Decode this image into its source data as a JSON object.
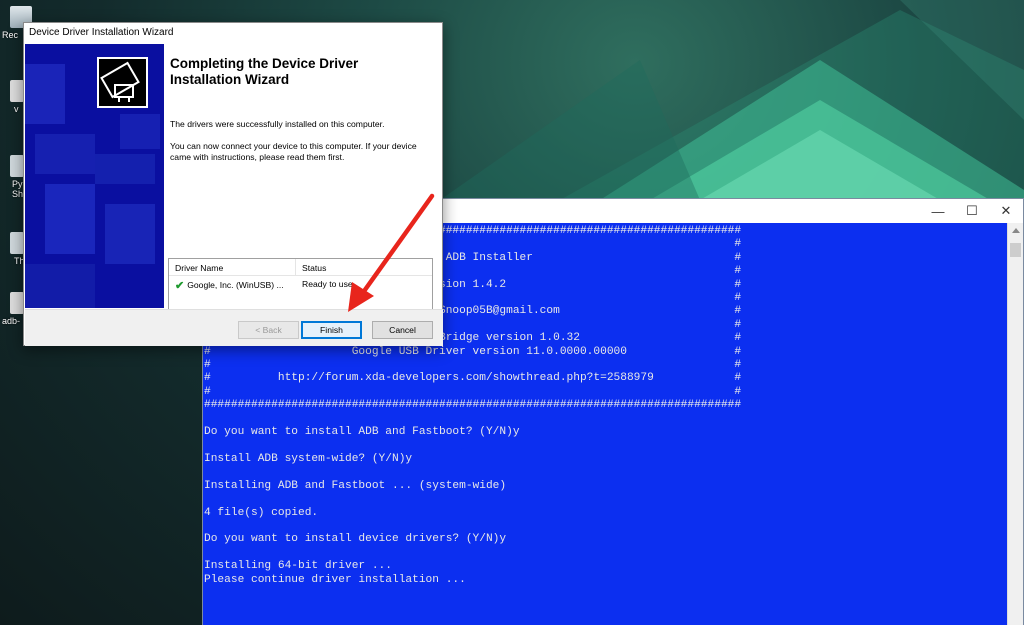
{
  "desktop": {
    "icons": [
      {
        "label": "Rec",
        "icon": "recycle-bin-icon"
      },
      {
        "label": "v",
        "icon": "file-icon"
      },
      {
        "label": "Py",
        "icon": "shortcut-icon"
      },
      {
        "label": "Sh",
        "icon": "shortcut-icon"
      },
      {
        "label": "Th",
        "icon": "shortcut-icon"
      },
      {
        "label": "adb-",
        "icon": "file-icon"
      }
    ]
  },
  "wizard": {
    "title": "Device Driver Installation Wizard",
    "heading": "Completing the Device Driver Installation Wizard",
    "success_text": "The drivers were successfully installed on this computer.",
    "instructions_text": "You can now connect your device to this computer. If your device came with instructions, please read them first.",
    "table": {
      "headers": [
        "Driver Name",
        "Status"
      ],
      "rows": [
        {
          "name": "Google, Inc. (WinUSB) ...",
          "status": "Ready to use",
          "icon": "checkmark-icon"
        }
      ]
    },
    "buttons": {
      "back": "< Back",
      "finish": "Finish",
      "cancel": "Cancel"
    }
  },
  "console": {
    "caption": {
      "minimize": "—",
      "maximize": "☐",
      "close": "✕"
    },
    "lines": [
      "################################################################################",
      "#                                                                              #",
      "#                                ds ADB Installer                              #",
      "#                                                                              #",
      "#                                ersion 1.4.2                                  #",
      "#                                                                              #",
      "#                                  Snoop05B@gmail.com                          #",
      "#                                                                              #",
      "#                                  Bridge version 1.0.32                       #",
      "#                     Google USB Driver version 11.0.0000.00000                #",
      "#                                                                              #",
      "#          http://forum.xda-developers.com/showthread.php?t=2588979            #",
      "#                                                                              #",
      "################################################################################",
      "",
      "Do you want to install ADB and Fastboot? (Y/N)y",
      "",
      "Install ADB system-wide? (Y/N)y",
      "",
      "Installing ADB and Fastboot ... (system-wide)",
      "",
      "4 file(s) copied.",
      "",
      "Do you want to install device drivers? (Y/N)y",
      "",
      "Installing 64-bit driver ...",
      "Please continue driver installation ..."
    ]
  },
  "colors": {
    "console_bg": "#0c2ff0",
    "wizard_banner": "#0a0fa0",
    "annotation_arrow": "#e8251c"
  }
}
